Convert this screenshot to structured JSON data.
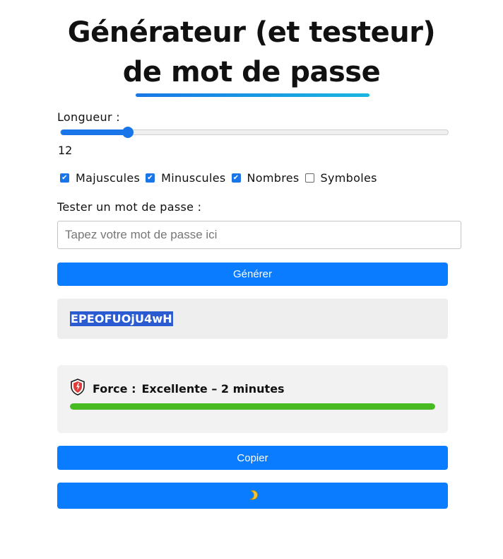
{
  "title": {
    "line1": "Générateur (et testeur)",
    "line2": "de mot de passe"
  },
  "length": {
    "label": "Longueur :",
    "value": "12",
    "min": 4,
    "max": 50
  },
  "options": [
    {
      "label": "Majuscules",
      "checked": true
    },
    {
      "label": "Minuscules",
      "checked": true
    },
    {
      "label": "Nombres",
      "checked": true
    },
    {
      "label": "Symboles",
      "checked": false
    }
  ],
  "tester": {
    "label": "Tester un mot de passe :",
    "placeholder": "Tapez votre mot de passe ici"
  },
  "buttons": {
    "generate": "Générer",
    "copy": "Copier",
    "theme_icon": "moon-icon"
  },
  "generated_password": "EPEOFUOjU4wH",
  "strength": {
    "prefix": "Force :",
    "value": "Excellente – 2 minutes",
    "level": 1.0,
    "icon": "shield-icon"
  },
  "colors": {
    "accent": "#0a7cff",
    "strength_bar": "#49bb22",
    "underline_start": "#1877e6",
    "underline_end": "#19b6e0"
  }
}
